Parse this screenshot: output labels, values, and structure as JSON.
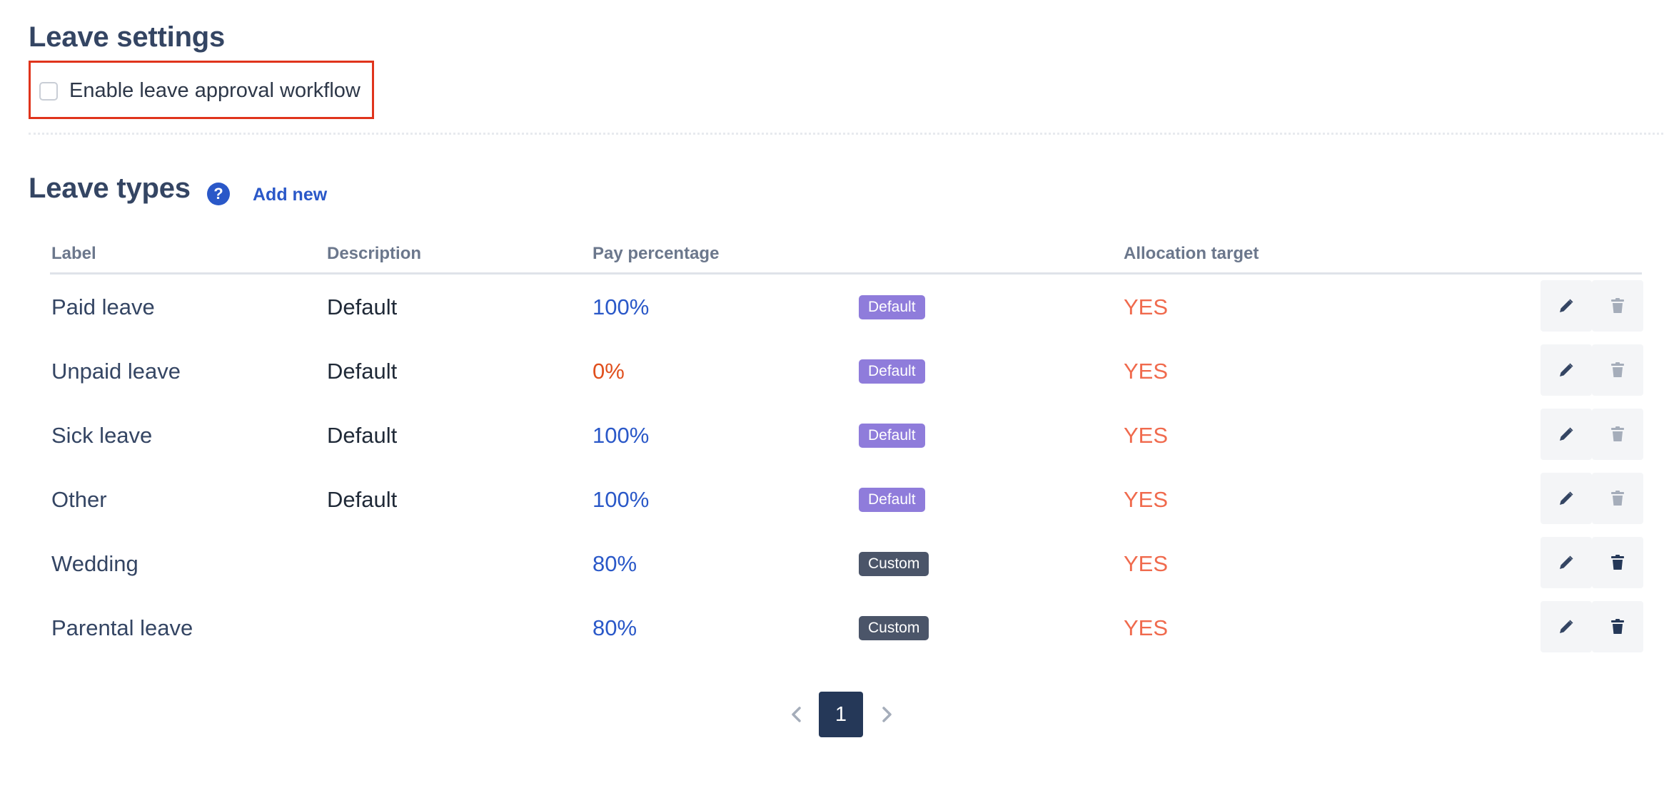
{
  "leave_settings": {
    "title": "Leave settings",
    "approval_workflow": {
      "label": "Enable leave approval workflow",
      "checked": false
    }
  },
  "leave_types": {
    "title": "Leave types",
    "help_icon": "?",
    "add_new_label": "Add new",
    "columns": {
      "label": "Label",
      "description": "Description",
      "pay_percentage": "Pay percentage",
      "allocation_target": "Allocation target"
    },
    "rows": [
      {
        "label": "Paid leave",
        "description": "Default",
        "pay": "100%",
        "pay_color": "#2a58c8",
        "badge": "Default",
        "allocation": "YES",
        "delete_enabled": false
      },
      {
        "label": "Unpaid leave",
        "description": "Default",
        "pay": "0%",
        "pay_color": "#e0501e",
        "badge": "Default",
        "allocation": "YES",
        "delete_enabled": false
      },
      {
        "label": "Sick leave",
        "description": "Default",
        "pay": "100%",
        "pay_color": "#2a58c8",
        "badge": "Default",
        "allocation": "YES",
        "delete_enabled": false
      },
      {
        "label": "Other",
        "description": "Default",
        "pay": "100%",
        "pay_color": "#2a58c8",
        "badge": "Default",
        "allocation": "YES",
        "delete_enabled": false
      },
      {
        "label": "Wedding",
        "description": "",
        "pay": "80%",
        "pay_color": "#2a58c8",
        "badge": "Custom",
        "allocation": "YES",
        "delete_enabled": true
      },
      {
        "label": "Parental leave",
        "description": "",
        "pay": "80%",
        "pay_color": "#2a58c8",
        "badge": "Custom",
        "allocation": "YES",
        "delete_enabled": true
      }
    ],
    "icons": {
      "edit": "pencil-icon",
      "delete": "trash-icon"
    }
  },
  "pagination": {
    "current_page": "1",
    "prev_icon": "chevron-left-icon",
    "next_icon": "chevron-right-icon"
  },
  "colors": {
    "accent": "#2a58c8",
    "highlight_border": "#e0341c",
    "default_badge": "#8f7cdb",
    "custom_badge": "#4b5569",
    "allocation_yes": "#f06a4d"
  }
}
